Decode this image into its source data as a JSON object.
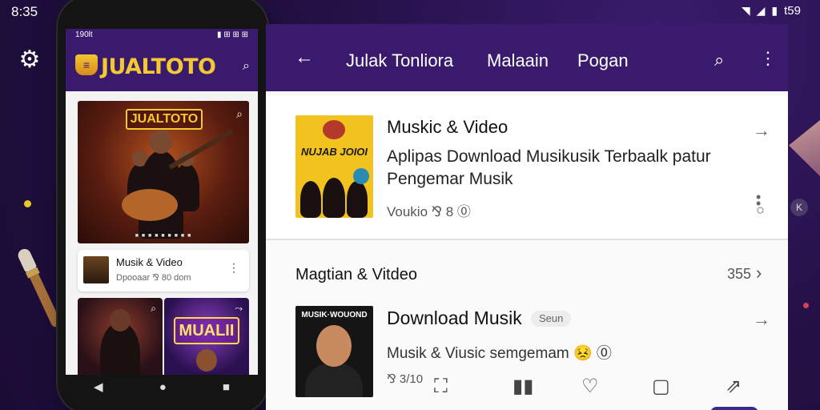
{
  "status_bar": {
    "time": "8:35",
    "battery": "t59"
  },
  "phone": {
    "status_left": "190lt",
    "status_right": "▮ ⊞ ⊞ ⊞",
    "logo_text": "JUALTOTO",
    "hero_badge": "JUALTOTO",
    "item": {
      "title": "Musik & Video",
      "subtitle": "Dpooaar ⅋ 80 dom"
    },
    "tile_b_banner": "MUALII"
  },
  "main": {
    "tabs": [
      "Julak Tonliora",
      "Malaain",
      "Pogan"
    ],
    "card1": {
      "thumb_caption": "NUJAB JOIOI",
      "title": "Muskic & Video",
      "description": "Aplipas Download Musikusik Terbaalk patur Pengemar Musik",
      "meta": "Voukio ⅋ 8 ⓪"
    },
    "section": {
      "title": "Magtian & Vitdeo",
      "count": "355"
    },
    "card2": {
      "thumb_caption": "MUSIK·WOUOND",
      "title": "Download Musik",
      "badge": "Seun",
      "description": "Musik & Viusic semgemam 😣 ⓪",
      "meta": "⅋ 3/10"
    }
  },
  "icons": {
    "back": "←",
    "search": "⌕",
    "more": "⋮",
    "arrow": "→",
    "chevron": "›",
    "gear": "⚙",
    "heart": "♡"
  },
  "colors": {
    "primary": "#3a1a6c",
    "accent": "#f3c933",
    "background": "#231044"
  }
}
